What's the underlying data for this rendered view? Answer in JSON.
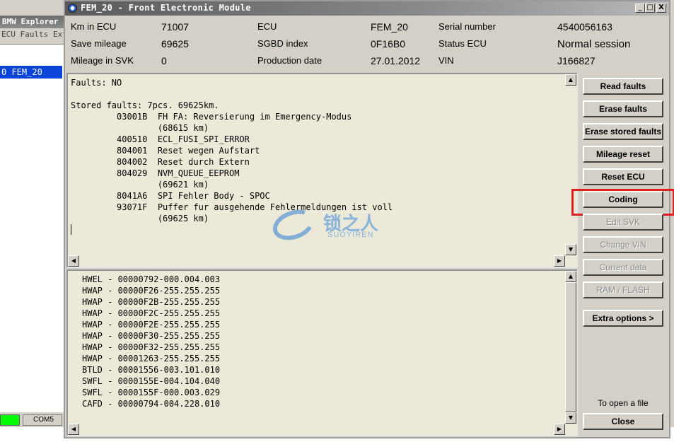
{
  "background_window": {
    "title": "BMW Explorer",
    "menu": [
      "ECU",
      "Faults",
      "Ext"
    ],
    "selected_item": "0 FEM_20",
    "status_port": "COM5"
  },
  "window": {
    "title": "FEM_20 - Front Electronic Module",
    "controls": {
      "minimize": "_",
      "maximize": "□",
      "close": "X"
    }
  },
  "info": {
    "km_in_ecu": {
      "label": "Km in ECU",
      "value": "71007"
    },
    "save_mileage": {
      "label": "Save mileage",
      "value": "69625"
    },
    "mileage_in_svk": {
      "label": "Mileage in SVK",
      "value": "0"
    },
    "ecu": {
      "label": "ECU",
      "value": "FEM_20"
    },
    "sgbd_index": {
      "label": "SGBD index",
      "value": "0F16B0"
    },
    "production_date": {
      "label": "Production date",
      "value": "27.01.2012"
    },
    "serial_number": {
      "label": "Serial number",
      "value": "4540056163"
    },
    "status_ecu": {
      "label": "Status ECU",
      "value": "Normal session"
    },
    "vin": {
      "label": "VIN",
      "value": "J166827"
    }
  },
  "faults_text": "Faults: NO\n\nStored faults: 7pcs. 69625km.\n         03001B  FH FA: Reversierung im Emergency-Modus\n                 (68615 km)\n         400510  ECL_FUSI_SPI_ERROR\n         804001  Reset wegen Aufstart\n         804002  Reset durch Extern\n         804029  NVM_QUEUE_EEPROM\n                 (69621 km)\n         8041A6  SPI Fehler Body - SPOC\n         93071F  Puffer fur ausgehende Fehlermeldungen ist voll\n                 (69625 km)",
  "svk_lines": [
    "HWEL - 00000792-000.004.003",
    "HWAP - 00000F26-255.255.255",
    "HWAP - 00000F2B-255.255.255",
    "HWAP - 00000F2C-255.255.255",
    "HWAP - 00000F2E-255.255.255",
    "HWAP - 00000F30-255.255.255",
    "HWAP - 00000F32-255.255.255",
    "HWAP - 00001263-255.255.255",
    "BTLD - 00001556-003.101.010",
    "SWFL - 0000155E-004.104.040",
    "SWFL - 0000155F-000.003.029",
    "CAFD - 00000794-004.228.010"
  ],
  "buttons": {
    "read_faults": "Read faults",
    "erase_faults": "Erase faults",
    "erase_stored_faults": "Erase stored faults",
    "mileage_reset": "Mileage reset",
    "reset_ecu": "Reset ECU",
    "coding": "Coding",
    "edit_svk": "Edit SVK",
    "change_vin": "Change VIN",
    "current_data": "Current data",
    "ram_flash": "RAM / FLASH",
    "extra_options": "Extra options >",
    "open_file_hint": "To open a file",
    "close": "Close"
  },
  "watermark": {
    "text": "锁之人",
    "sub": "SUOYIREN"
  },
  "colors": {
    "highlight": "#e02020",
    "selected": "#0a44d8",
    "status_green": "#00ff00"
  }
}
